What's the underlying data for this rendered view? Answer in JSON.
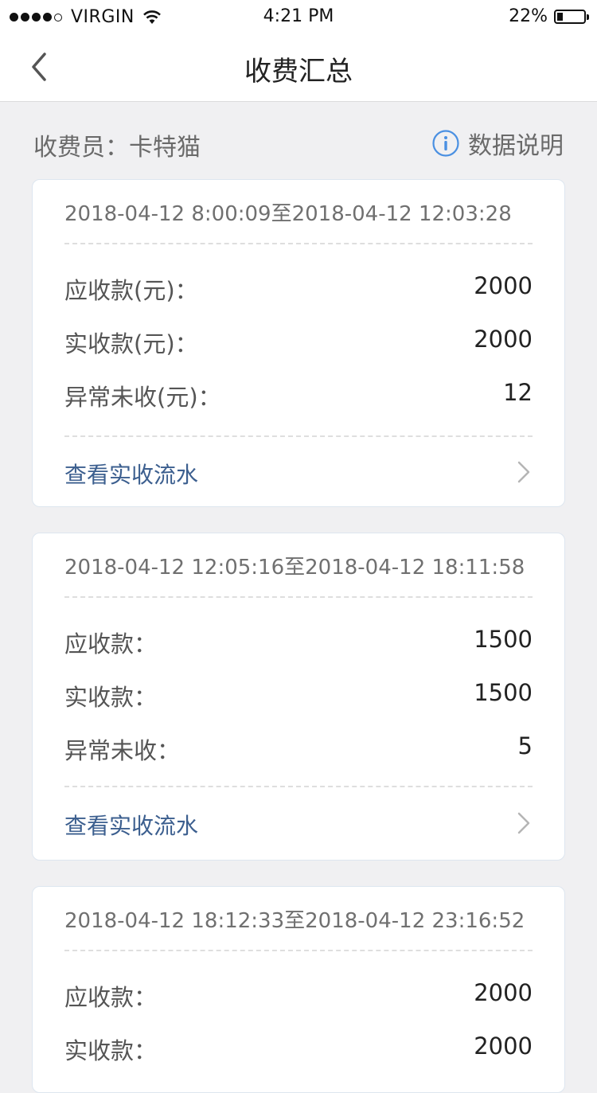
{
  "status_bar": {
    "carrier": "VIRGIN",
    "time": "4:21 PM",
    "battery": "22%",
    "battery_level": 0.22
  },
  "nav": {
    "title": "收费汇总",
    "back_icon": "chevron-left-icon"
  },
  "info": {
    "cashier": "收费员：卡特猫",
    "explain_label": "数据说明",
    "explain_icon": "info-circle-icon",
    "accent_color": "#4a90e2"
  },
  "cards": [
    {
      "period": "2018-04-12 8:00:09至2018-04-12 12:03:28",
      "rows": [
        {
          "label": "应收款(元)：",
          "value": "2000"
        },
        {
          "label": "实收款(元)：",
          "value": "2000"
        },
        {
          "label": "异常未收(元)：",
          "value": "12"
        }
      ],
      "link": "查看实收流水"
    },
    {
      "period": "2018-04-12 12:05:16至2018-04-12 18:11:58",
      "rows": [
        {
          "label": "应收款：",
          "value": "1500"
        },
        {
          "label": "实收款：",
          "value": "1500"
        },
        {
          "label": "异常未收：",
          "value": "5"
        }
      ],
      "link": "查看实收流水"
    },
    {
      "period": "2018-04-12 18:12:33至2018-04-12 23:16:52",
      "rows": [
        {
          "label": "应收款：",
          "value": "2000"
        },
        {
          "label": "实收款：",
          "value": "2000"
        }
      ]
    }
  ]
}
